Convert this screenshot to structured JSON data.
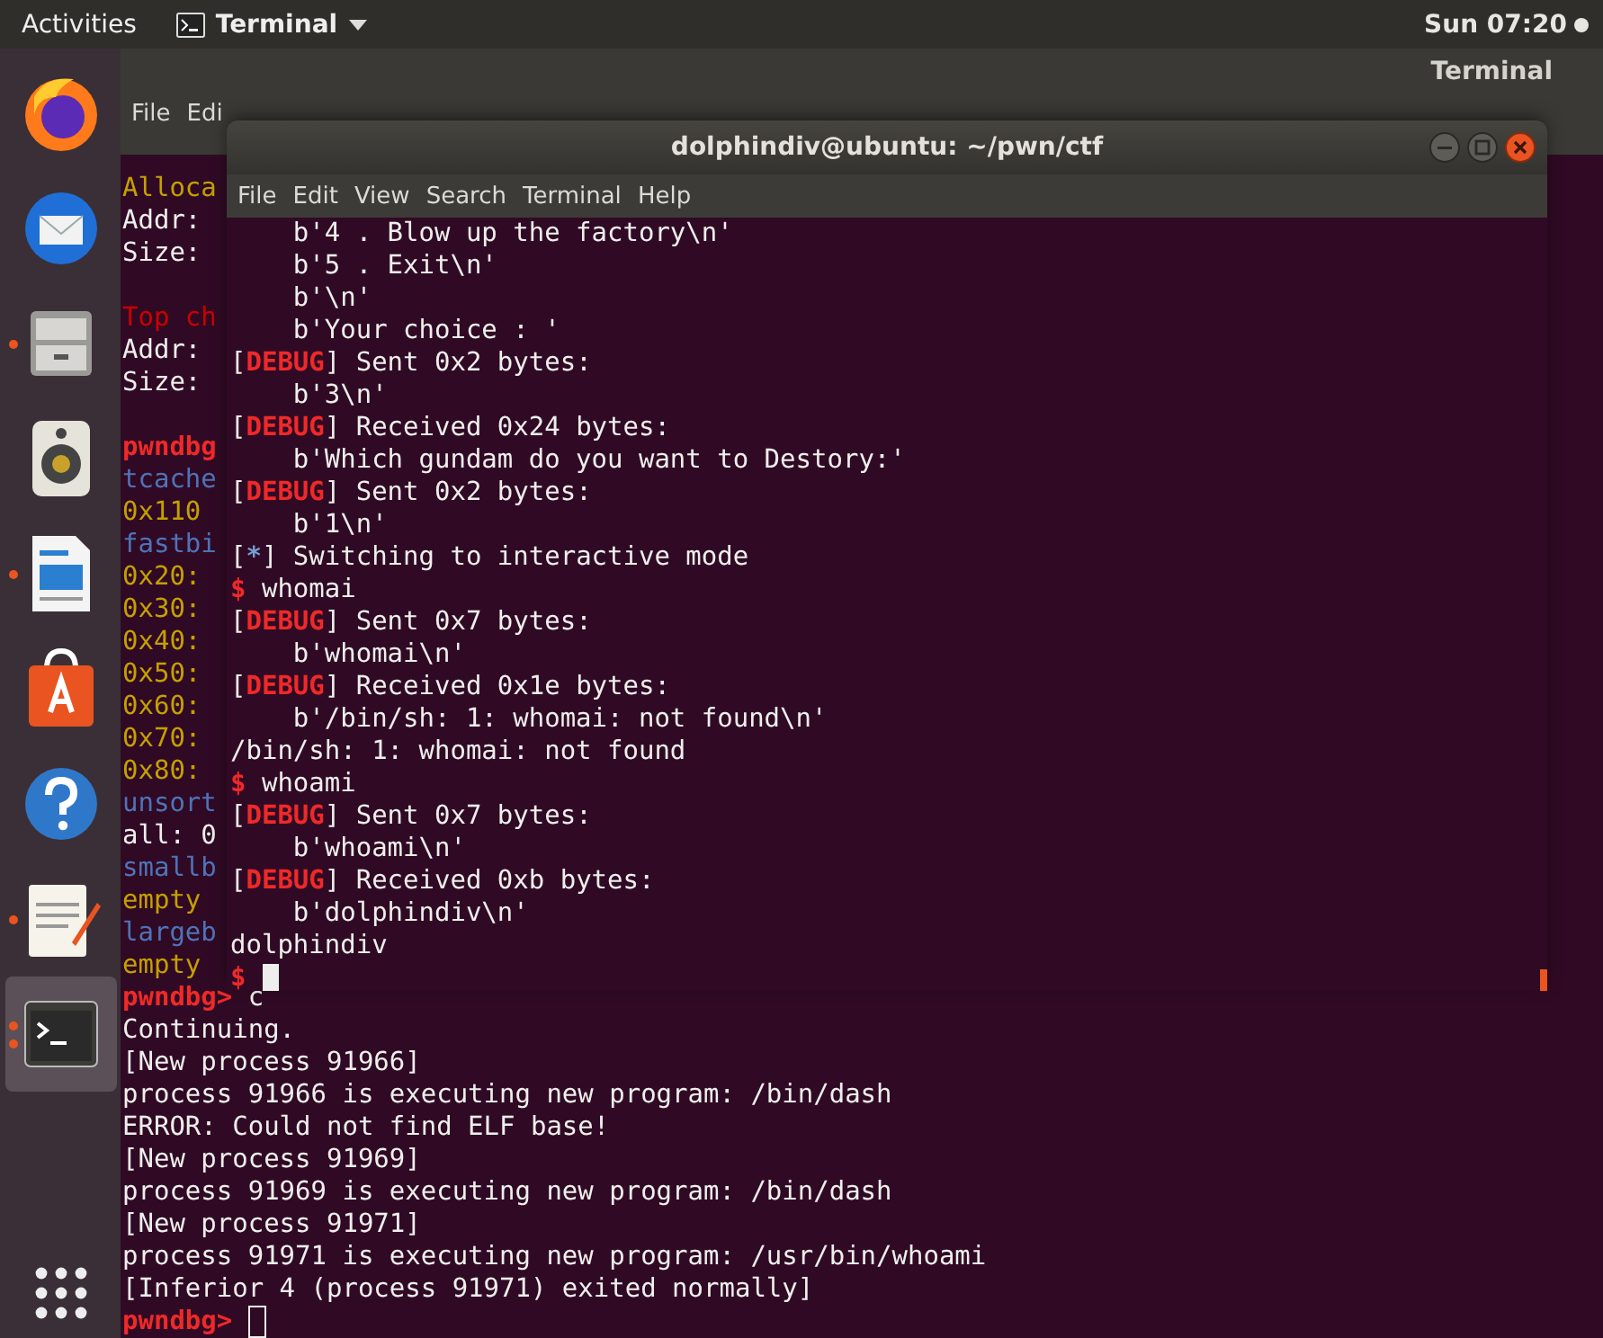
{
  "top_bar": {
    "activities": "Activities",
    "app_menu": "Terminal",
    "clock": "Sun 07:20"
  },
  "dock": {
    "items": [
      {
        "kind": "browser",
        "running": false,
        "selected": false
      },
      {
        "kind": "mail",
        "running": false,
        "selected": false
      },
      {
        "kind": "files",
        "running": true,
        "multiple_windows": false,
        "selected": false
      },
      {
        "kind": "speaker",
        "running": false,
        "selected": false
      },
      {
        "kind": "document",
        "running": true,
        "multiple_windows": false,
        "selected": false
      },
      {
        "kind": "store",
        "running": false,
        "selected": false
      },
      {
        "kind": "help",
        "running": false,
        "selected": false
      },
      {
        "kind": "editor",
        "running": true,
        "multiple_windows": false,
        "selected": false
      },
      {
        "kind": "terminal",
        "running": true,
        "multiple_windows": true,
        "selected": true
      }
    ]
  },
  "back_window": {
    "title": "Terminal",
    "menu": [
      "File",
      "Edi"
    ],
    "lines": [
      {
        "segments": [
          {
            "kind": "heading",
            "text": "Alloca"
          }
        ]
      },
      {
        "segments": [
          {
            "kind": "plain",
            "text": "Addr:"
          }
        ]
      },
      {
        "segments": [
          {
            "kind": "plain",
            "text": "Size:"
          }
        ]
      },
      {
        "blank": true
      },
      {
        "segments": [
          {
            "kind": "title",
            "text": "Top ch"
          }
        ]
      },
      {
        "segments": [
          {
            "kind": "plain",
            "text": "Addr:"
          }
        ]
      },
      {
        "segments": [
          {
            "kind": "plain",
            "text": "Size:"
          }
        ]
      },
      {
        "blank": true
      },
      {
        "segments": [
          {
            "kind": "prompt",
            "text": "pwndbg"
          }
        ]
      },
      {
        "segments": [
          {
            "kind": "bin",
            "text": "tcache"
          }
        ]
      },
      {
        "segments": [
          {
            "kind": "heading",
            "text": "0x110"
          }
        ]
      },
      {
        "segments": [
          {
            "kind": "bin",
            "text": "fastbi"
          }
        ]
      },
      {
        "segments": [
          {
            "kind": "heading",
            "text": "0x20:"
          }
        ]
      },
      {
        "segments": [
          {
            "kind": "heading",
            "text": "0x30:"
          }
        ]
      },
      {
        "segments": [
          {
            "kind": "heading",
            "text": "0x40:"
          }
        ]
      },
      {
        "segments": [
          {
            "kind": "heading",
            "text": "0x50:"
          }
        ]
      },
      {
        "segments": [
          {
            "kind": "heading",
            "text": "0x60:"
          }
        ]
      },
      {
        "segments": [
          {
            "kind": "heading",
            "text": "0x70:"
          }
        ]
      },
      {
        "segments": [
          {
            "kind": "heading",
            "text": "0x80:"
          }
        ]
      },
      {
        "segments": [
          {
            "kind": "bin",
            "text": "unsort"
          }
        ]
      },
      {
        "segments": [
          {
            "kind": "plain",
            "text": "all: 0"
          }
        ]
      },
      {
        "segments": [
          {
            "kind": "bin",
            "text": "smallb"
          }
        ]
      },
      {
        "segments": [
          {
            "kind": "heading",
            "text": "empty"
          }
        ]
      },
      {
        "segments": [
          {
            "kind": "bin",
            "text": "largeb"
          }
        ]
      },
      {
        "segments": [
          {
            "kind": "heading",
            "text": "empty"
          }
        ]
      },
      {
        "segments": [
          {
            "kind": "prompt",
            "text": "pwndbg>"
          },
          {
            "kind": "plain",
            "text": " c"
          }
        ]
      },
      {
        "segments": [
          {
            "kind": "plain",
            "text": "Continuing."
          }
        ]
      },
      {
        "segments": [
          {
            "kind": "plain",
            "text": "[New process 91966]"
          }
        ]
      },
      {
        "segments": [
          {
            "kind": "plain",
            "text": "process 91966 is executing new program: /bin/dash"
          }
        ]
      },
      {
        "segments": [
          {
            "kind": "plain",
            "text": "ERROR: Could not find ELF base!"
          }
        ]
      },
      {
        "segments": [
          {
            "kind": "plain",
            "text": "[New process 91969]"
          }
        ]
      },
      {
        "segments": [
          {
            "kind": "plain",
            "text": "process 91969 is executing new program: /bin/dash"
          }
        ]
      },
      {
        "segments": [
          {
            "kind": "plain",
            "text": "[New process 91971]"
          }
        ]
      },
      {
        "segments": [
          {
            "kind": "plain",
            "text": "process 91971 is executing new program: /usr/bin/whoami"
          }
        ]
      },
      {
        "segments": [
          {
            "kind": "plain",
            "text": "[Inferior 4 (process 91971) exited normally]"
          }
        ]
      },
      {
        "segments": [
          {
            "kind": "prompt",
            "text": "pwndbg>"
          }
        ],
        "cursor_focused": false
      }
    ]
  },
  "front_window": {
    "title": "dolphindiv@ubuntu: ~/pwn/ctf",
    "menu": [
      "File",
      "Edit",
      "View",
      "Search",
      "Terminal",
      "Help"
    ],
    "lines": [
      {
        "segments": [
          {
            "kind": "plain",
            "text": "    b'4 . Blow up the factory\\n'"
          }
        ]
      },
      {
        "segments": [
          {
            "kind": "plain",
            "text": "    b'5 . Exit\\n'"
          }
        ]
      },
      {
        "segments": [
          {
            "kind": "plain",
            "text": "    b'\\n'"
          }
        ]
      },
      {
        "segments": [
          {
            "kind": "plain",
            "text": "    b'Your choice : '"
          }
        ]
      },
      {
        "segments": [
          {
            "kind": "plain",
            "text": "["
          },
          {
            "kind": "tag",
            "text": "DEBUG"
          },
          {
            "kind": "plain",
            "text": "] Sent 0x2 bytes:"
          }
        ]
      },
      {
        "segments": [
          {
            "kind": "plain",
            "text": "    b'3\\n'"
          }
        ]
      },
      {
        "segments": [
          {
            "kind": "plain",
            "text": "["
          },
          {
            "kind": "tag",
            "text": "DEBUG"
          },
          {
            "kind": "plain",
            "text": "] Received 0x24 bytes:"
          }
        ]
      },
      {
        "segments": [
          {
            "kind": "plain",
            "text": "    b'Which gundam do you want to Destory:'"
          }
        ]
      },
      {
        "segments": [
          {
            "kind": "plain",
            "text": "["
          },
          {
            "kind": "tag",
            "text": "DEBUG"
          },
          {
            "kind": "plain",
            "text": "] Sent 0x2 bytes:"
          }
        ]
      },
      {
        "segments": [
          {
            "kind": "plain",
            "text": "    b'1\\n'"
          }
        ]
      },
      {
        "segments": [
          {
            "kind": "plain",
            "text": "["
          },
          {
            "kind": "star",
            "text": "*"
          },
          {
            "kind": "plain",
            "text": "] Switching to interactive mode"
          }
        ]
      },
      {
        "segments": [
          {
            "kind": "prompt",
            "text": "$"
          },
          {
            "kind": "plain",
            "text": " whomai"
          }
        ]
      },
      {
        "segments": [
          {
            "kind": "plain",
            "text": "["
          },
          {
            "kind": "tag",
            "text": "DEBUG"
          },
          {
            "kind": "plain",
            "text": "] Sent 0x7 bytes:"
          }
        ]
      },
      {
        "segments": [
          {
            "kind": "plain",
            "text": "    b'whomai\\n'"
          }
        ]
      },
      {
        "segments": [
          {
            "kind": "plain",
            "text": "["
          },
          {
            "kind": "tag",
            "text": "DEBUG"
          },
          {
            "kind": "plain",
            "text": "] Received 0x1e bytes:"
          }
        ]
      },
      {
        "segments": [
          {
            "kind": "plain",
            "text": "    b'/bin/sh: 1: whomai: not found\\n'"
          }
        ]
      },
      {
        "segments": [
          {
            "kind": "plain",
            "text": "/bin/sh: 1: whomai: not found"
          }
        ]
      },
      {
        "segments": [
          {
            "kind": "prompt",
            "text": "$"
          },
          {
            "kind": "plain",
            "text": " whoami"
          }
        ]
      },
      {
        "segments": [
          {
            "kind": "plain",
            "text": "["
          },
          {
            "kind": "tag",
            "text": "DEBUG"
          },
          {
            "kind": "plain",
            "text": "] Sent 0x7 bytes:"
          }
        ]
      },
      {
        "segments": [
          {
            "kind": "plain",
            "text": "    b'whoami\\n'"
          }
        ]
      },
      {
        "segments": [
          {
            "kind": "plain",
            "text": "["
          },
          {
            "kind": "tag",
            "text": "DEBUG"
          },
          {
            "kind": "plain",
            "text": "] Received 0xb bytes:"
          }
        ]
      },
      {
        "segments": [
          {
            "kind": "plain",
            "text": "    b'dolphindiv\\n'"
          }
        ]
      },
      {
        "segments": [
          {
            "kind": "plain",
            "text": "dolphindiv"
          }
        ]
      },
      {
        "segments": [
          {
            "kind": "prompt",
            "text": "$"
          }
        ],
        "cursor_focused": true
      }
    ]
  }
}
